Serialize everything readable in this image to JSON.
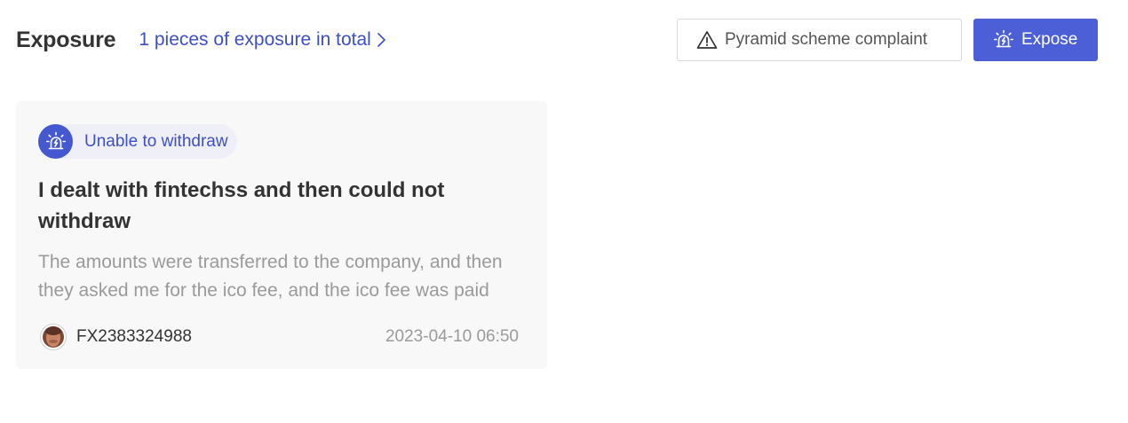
{
  "header": {
    "title": "Exposure",
    "total_link": "1 pieces of exposure in total",
    "complaint_button": "Pyramid scheme complaint",
    "expose_button": "Expose"
  },
  "cards": [
    {
      "tag": "Unable to withdraw",
      "title": "I dealt with fintechss and then could not withdraw",
      "description": "The amounts were transferred to the company, and then they asked me for the ico fee, and the ico fee was paid",
      "user": "FX2383324988",
      "date": "2023-04-10 06:50"
    }
  ],
  "colors": {
    "accent": "#4c5fd6",
    "link": "#3d4fc6",
    "tag_background": "#eff0f7",
    "card_background": "#f8f8f9"
  },
  "icons": {
    "chevron": "chevron-right-icon",
    "complaint": "warning-triangle-icon",
    "expose": "alarm-siren-icon",
    "tag": "alarm-siren-icon",
    "avatar": "user-avatar"
  }
}
